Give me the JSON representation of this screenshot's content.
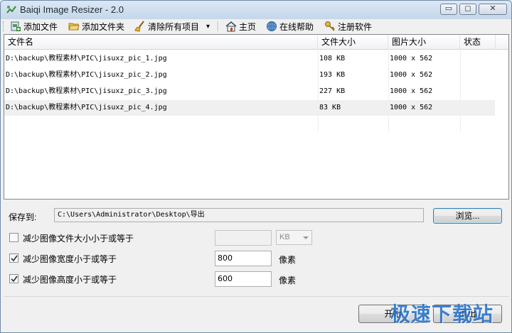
{
  "window": {
    "title": "Baiqi Image Resizer - 2.0",
    "minimize_glyph": "▭",
    "maximize_glyph": "◻",
    "close_glyph": "✕"
  },
  "toolbar": {
    "add_file": {
      "label": "添加文件",
      "icon": "add-file-icon"
    },
    "add_folder": {
      "label": "添加文件夹",
      "icon": "folder-open-icon"
    },
    "clear_all": {
      "label": "清除所有项目",
      "icon": "broom-icon"
    },
    "clear_dropdown": "▾",
    "home": {
      "label": "主页",
      "icon": "home-icon"
    },
    "help": {
      "label": "在线帮助",
      "icon": "help-icon"
    },
    "register": {
      "label": "注册软件",
      "icon": "key-icon"
    }
  },
  "file_list": {
    "columns": [
      "文件名",
      "文件大小",
      "图片大小",
      "状态"
    ],
    "rows": [
      {
        "name": "D:\\backup\\教程素材\\PIC\\jisuxz_pic_1.jpg",
        "size": "108 KB",
        "dimensions": "1000 x 562",
        "status": ""
      },
      {
        "name": "D:\\backup\\教程素材\\PIC\\jisuxz_pic_2.jpg",
        "size": "193 KB",
        "dimensions": "1000 x 562",
        "status": ""
      },
      {
        "name": "D:\\backup\\教程素材\\PIC\\jisuxz_pic_3.jpg",
        "size": "227 KB",
        "dimensions": "1000 x 562",
        "status": ""
      },
      {
        "name": "D:\\backup\\教程素材\\PIC\\jisuxz_pic_4.jpg",
        "size": "83 KB",
        "dimensions": "1000 x 562",
        "status": ""
      }
    ]
  },
  "save_to": {
    "label": "保存到:",
    "path": "C:\\Users\\Administrator\\Desktop\\导出",
    "browse_label": "浏览..."
  },
  "options": {
    "reduce_filesize": {
      "label": "减少图像文件大小小于或等于",
      "checked": false,
      "value": "",
      "unit": "KB"
    },
    "reduce_width": {
      "label": "减少图像宽度小于或等于",
      "checked": true,
      "value": "800",
      "unit": "像素"
    },
    "reduce_height": {
      "label": "减少图像高度小于或等于",
      "checked": true,
      "value": "600",
      "unit": "像素"
    }
  },
  "actions": {
    "start_label": "开始",
    "exit_label": "退出"
  },
  "watermark": "极速下载站",
  "colors": {
    "accent": "#3c7fb1",
    "watermark": "#1f6ec9",
    "titlebar": "#c6d7ea"
  }
}
